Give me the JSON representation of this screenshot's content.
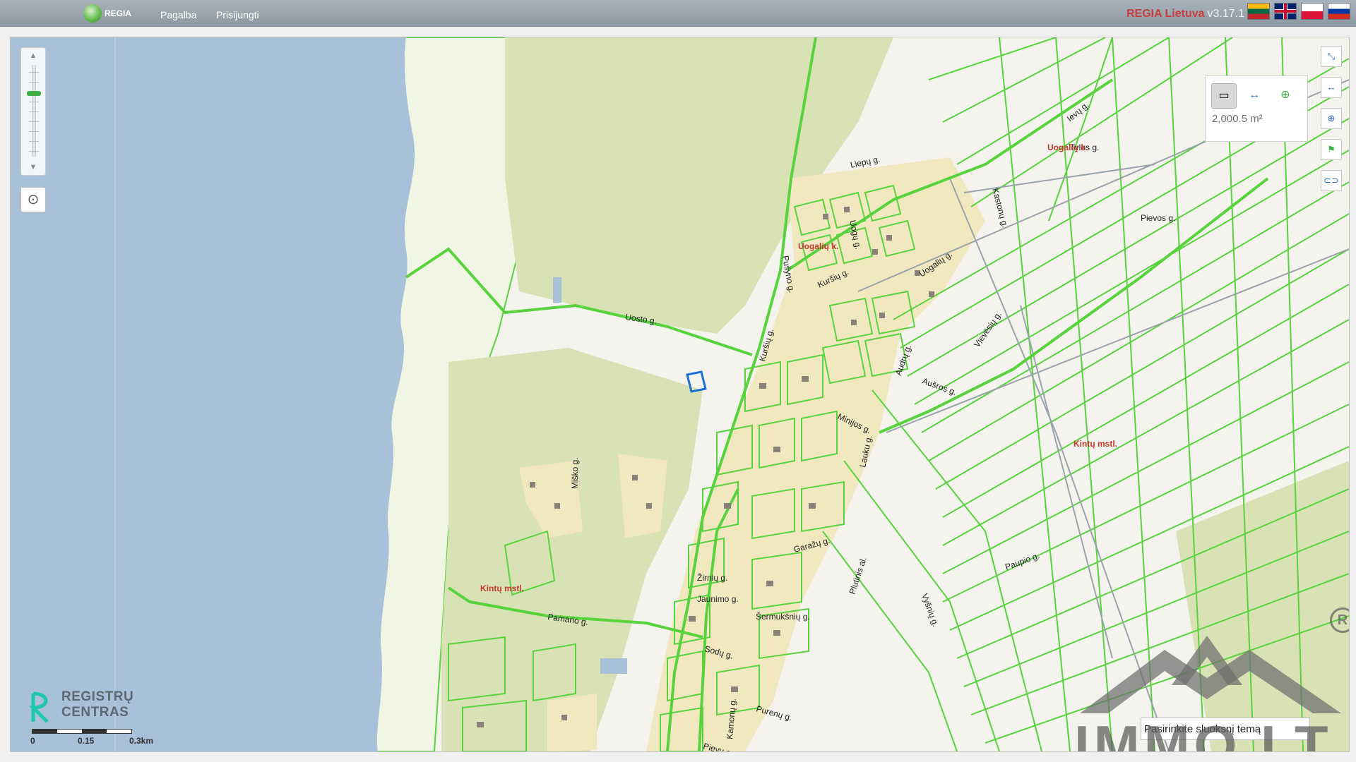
{
  "header": {
    "logo_text": "REGIA",
    "nav": [
      {
        "label": "Pagalba"
      },
      {
        "label": "Prisijungti"
      }
    ],
    "brand": "REGIA Lietuva",
    "version": "v3.17.1",
    "flags": [
      "lt-flag-icon",
      "gb-flag-icon",
      "pl-flag-icon",
      "ru-flag-icon"
    ]
  },
  "map": {
    "street_labels": [
      "Uosto g.",
      "Liepų g.",
      "Uogų g.",
      "Kuršių g.",
      "Kastonų g.",
      "Uogalių g.",
      "Ievų g.",
      "Aušros g.",
      "Vievėsių g.",
      "Audrų g.",
      "Minijos g.",
      "Lauku g.",
      "Miško g.",
      "Garažų g.",
      "Plutinis al.",
      "Vyšnių g.",
      "Paupio g.",
      "Žirnių g.",
      "Jaunimo g.",
      "Šermukšnių g.",
      "Pamario g.",
      "Sodų g.",
      "Purenų g.",
      "Kamonų g.",
      "Pievų g.",
      "Pušyno g.",
      "Kuršių g.",
      "Tylos g.",
      "Pievos g."
    ],
    "place_labels": [
      "Uogalių k.",
      "Uogalių k.",
      "Kintų mstl.",
      "Kintų mstl."
    ],
    "measure_value": "2,000.5 m²",
    "scale_labels": [
      "0",
      "0.15",
      "0.3km"
    ],
    "layer_input_value": "Pasirinkite sluoksnį temą",
    "registry_logo": [
      "REGISTRŲ",
      "CENTRAS"
    ],
    "watermark": "IMMO.LT",
    "colors": {
      "water": "#a9c1d8",
      "parcel_outline": "#58d33e",
      "forest": "#d9e2b4",
      "settlement": "#f2e8c0",
      "selected_parcel": "#1a6fd8",
      "brand": "#c83c3c"
    }
  }
}
